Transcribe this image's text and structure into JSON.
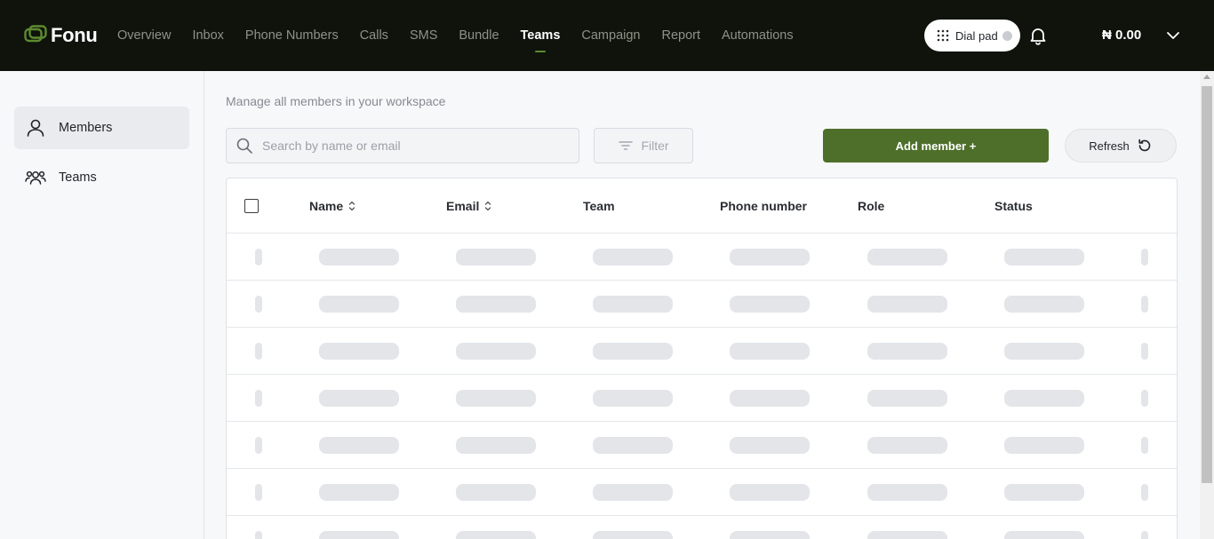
{
  "app": {
    "name": "Fonu"
  },
  "nav": {
    "items": [
      {
        "label": "Overview",
        "active": false
      },
      {
        "label": "Inbox",
        "active": false
      },
      {
        "label": "Phone Numbers",
        "active": false
      },
      {
        "label": "Calls",
        "active": false
      },
      {
        "label": "SMS",
        "active": false
      },
      {
        "label": "Bundle",
        "active": false
      },
      {
        "label": "Teams",
        "active": true
      },
      {
        "label": "Campaign",
        "active": false
      },
      {
        "label": "Report",
        "active": false
      },
      {
        "label": "Automations",
        "active": false
      }
    ],
    "accent_color": "#5e8a2f"
  },
  "header": {
    "dialpad_label": "Dial pad",
    "balance": "₦ 0.00",
    "icons": [
      "dialpad-grid-icon",
      "bell-icon",
      "chevron-down-icon"
    ]
  },
  "sidebar": {
    "items": [
      {
        "label": "Members",
        "icon": "user-icon",
        "active": true
      },
      {
        "label": "Teams",
        "icon": "users-group-icon",
        "active": false
      }
    ]
  },
  "main": {
    "subtitle": "Manage all members in your workspace",
    "search": {
      "placeholder": "Search by name or email",
      "value": ""
    },
    "filter_label": "Filter",
    "add_member_label": "Add member +",
    "refresh_label": "Refresh",
    "primary_color": "#4e6f2a"
  },
  "table": {
    "columns": [
      {
        "label": "Name",
        "sortable": true
      },
      {
        "label": "Email",
        "sortable": true
      },
      {
        "label": "Team",
        "sortable": false
      },
      {
        "label": "Phone number",
        "sortable": false
      },
      {
        "label": "Role",
        "sortable": false
      },
      {
        "label": "Status",
        "sortable": false
      }
    ],
    "loading": true,
    "skeleton_rows": 7
  }
}
